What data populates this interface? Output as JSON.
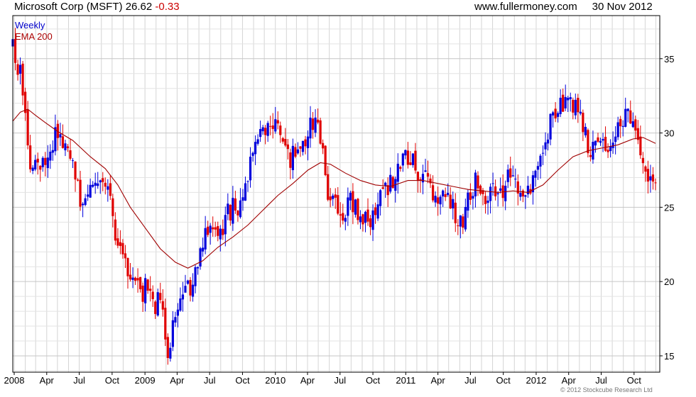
{
  "header": {
    "security": "Microsoft Corp (MSFT)",
    "last_price": "26.62",
    "change": "-0.33",
    "source": "www.fullermoney.com",
    "date": "30 Nov 2012"
  },
  "legend": {
    "weekly": "Weekly",
    "ema": "EMA 200"
  },
  "copyright": "© 2012 Stockcube Research Ltd",
  "colors": {
    "up_candle": "#0000dd",
    "down_candle": "#e00000",
    "ema_line": "#a00000",
    "grid": "#d4d4d4",
    "change_text": "#cc0000"
  },
  "chart_data": {
    "type": "candlestick",
    "grid": true,
    "legend_position": "top-left",
    "y_axis_position": "right",
    "ylim": [
      13.9,
      37.9
    ],
    "y_ticks": [
      15,
      20,
      25,
      30,
      35
    ],
    "x_ticks": [
      {
        "label": "2008",
        "date": "2008-01-01"
      },
      {
        "label": "Apr",
        "date": "2008-04-01"
      },
      {
        "label": "Jul",
        "date": "2008-07-01"
      },
      {
        "label": "Oct",
        "date": "2008-10-01"
      },
      {
        "label": "2009",
        "date": "2009-01-01"
      },
      {
        "label": "Apr",
        "date": "2009-04-01"
      },
      {
        "label": "Jul",
        "date": "2009-07-01"
      },
      {
        "label": "Oct",
        "date": "2009-10-01"
      },
      {
        "label": "2010",
        "date": "2010-01-01"
      },
      {
        "label": "Apr",
        "date": "2010-04-01"
      },
      {
        "label": "Jul",
        "date": "2010-07-01"
      },
      {
        "label": "Oct",
        "date": "2010-10-01"
      },
      {
        "label": "2011",
        "date": "2011-01-01"
      },
      {
        "label": "Apr",
        "date": "2011-04-01"
      },
      {
        "label": "Jul",
        "date": "2011-07-01"
      },
      {
        "label": "Oct",
        "date": "2011-10-01"
      },
      {
        "label": "2012",
        "date": "2012-01-01"
      },
      {
        "label": "Apr",
        "date": "2012-04-01"
      },
      {
        "label": "Jul",
        "date": "2012-07-01"
      },
      {
        "label": "Oct",
        "date": "2012-10-01"
      }
    ],
    "x_range": [
      "2007-12-28",
      "2012-12-12"
    ],
    "close_path": [
      [
        "2007-12-28",
        35.6
      ],
      [
        "2008-01-18",
        34.0
      ],
      [
        "2008-02-01",
        31.0
      ],
      [
        "2008-02-15",
        28.3
      ],
      [
        "2008-03-07",
        27.3
      ],
      [
        "2008-03-28",
        28.5
      ],
      [
        "2008-04-18",
        29.4
      ],
      [
        "2008-05-02",
        30.0
      ],
      [
        "2008-05-16",
        29.5
      ],
      [
        "2008-05-30",
        28.5
      ],
      [
        "2008-06-20",
        27.5
      ],
      [
        "2008-07-04",
        25.6
      ],
      [
        "2008-07-25",
        25.8
      ],
      [
        "2008-08-15",
        27.2
      ],
      [
        "2008-09-05",
        27.4
      ],
      [
        "2008-09-19",
        26.2
      ],
      [
        "2008-10-03",
        24.0
      ],
      [
        "2008-10-17",
        23.0
      ],
      [
        "2008-10-31",
        22.2
      ],
      [
        "2008-11-21",
        19.5
      ],
      [
        "2008-12-05",
        19.8
      ],
      [
        "2008-12-26",
        19.3
      ],
      [
        "2009-01-09",
        19.8
      ],
      [
        "2009-01-30",
        17.8
      ],
      [
        "2009-02-13",
        19.3
      ],
      [
        "2009-03-06",
        15.5
      ],
      [
        "2009-03-27",
        17.8
      ],
      [
        "2009-04-17",
        19.0
      ],
      [
        "2009-05-08",
        19.5
      ],
      [
        "2009-05-29",
        20.8
      ],
      [
        "2009-06-19",
        23.5
      ],
      [
        "2009-07-10",
        23.3
      ],
      [
        "2009-07-31",
        23.5
      ],
      [
        "2009-08-21",
        24.5
      ],
      [
        "2009-09-11",
        25.1
      ],
      [
        "2009-10-02",
        25.3
      ],
      [
        "2009-10-23",
        28.0
      ],
      [
        "2009-11-13",
        29.5
      ],
      [
        "2009-12-04",
        29.8
      ],
      [
        "2009-12-25",
        30.6
      ],
      [
        "2010-01-15",
        30.3
      ],
      [
        "2010-02-05",
        28.2
      ],
      [
        "2010-02-26",
        28.6
      ],
      [
        "2010-03-19",
        29.5
      ],
      [
        "2010-04-09",
        30.4
      ],
      [
        "2010-04-23",
        30.8
      ],
      [
        "2010-05-14",
        28.5
      ],
      [
        "2010-05-28",
        25.8
      ],
      [
        "2010-06-18",
        25.5
      ],
      [
        "2010-07-09",
        24.3
      ],
      [
        "2010-07-30",
        25.8
      ],
      [
        "2010-08-20",
        24.3
      ],
      [
        "2010-09-10",
        24.0
      ],
      [
        "2010-10-01",
        24.4
      ],
      [
        "2010-10-22",
        25.5
      ],
      [
        "2010-11-12",
        26.5
      ],
      [
        "2010-12-03",
        27.3
      ],
      [
        "2010-12-24",
        28.3
      ],
      [
        "2011-01-14",
        28.4
      ],
      [
        "2011-02-04",
        27.5
      ],
      [
        "2011-02-25",
        26.8
      ],
      [
        "2011-03-18",
        25.5
      ],
      [
        "2011-04-08",
        25.8
      ],
      [
        "2011-04-29",
        25.8
      ],
      [
        "2011-05-20",
        24.5
      ],
      [
        "2011-06-10",
        24.0
      ],
      [
        "2011-07-01",
        26.0
      ],
      [
        "2011-07-22",
        27.0
      ],
      [
        "2011-08-12",
        25.5
      ],
      [
        "2011-09-02",
        26.5
      ],
      [
        "2011-09-23",
        25.8
      ],
      [
        "2011-10-14",
        27.0
      ],
      [
        "2011-11-04",
        26.3
      ],
      [
        "2011-11-25",
        25.4
      ],
      [
        "2011-12-16",
        26.2
      ],
      [
        "2012-01-06",
        27.8
      ],
      [
        "2012-01-27",
        29.4
      ],
      [
        "2012-02-17",
        31.3
      ],
      [
        "2012-03-09",
        32.0
      ],
      [
        "2012-03-30",
        32.3
      ],
      [
        "2012-04-20",
        31.8
      ],
      [
        "2012-05-11",
        30.5
      ],
      [
        "2012-06-01",
        28.5
      ],
      [
        "2012-06-22",
        29.8
      ],
      [
        "2012-07-13",
        29.0
      ],
      [
        "2012-08-03",
        29.5
      ],
      [
        "2012-08-24",
        30.7
      ],
      [
        "2012-09-14",
        31.0
      ],
      [
        "2012-10-05",
        29.8
      ],
      [
        "2012-10-26",
        28.4
      ],
      [
        "2012-11-16",
        26.8
      ],
      [
        "2012-11-30",
        26.62
      ]
    ],
    "ema_path": [
      [
        "2007-12-28",
        30.8
      ],
      [
        "2008-01-18",
        31.4
      ],
      [
        "2008-02-08",
        31.6
      ],
      [
        "2008-02-29",
        31.2
      ],
      [
        "2008-03-28",
        30.7
      ],
      [
        "2008-05-02",
        30.1
      ],
      [
        "2008-06-13",
        29.5
      ],
      [
        "2008-08-01",
        28.4
      ],
      [
        "2008-09-12",
        27.6
      ],
      [
        "2008-10-17",
        26.5
      ],
      [
        "2008-11-21",
        25.0
      ],
      [
        "2009-01-02",
        23.6
      ],
      [
        "2009-02-13",
        22.2
      ],
      [
        "2009-03-27",
        21.3
      ],
      [
        "2009-05-01",
        20.9
      ],
      [
        "2009-06-12",
        21.4
      ],
      [
        "2009-07-24",
        22.3
      ],
      [
        "2009-09-04",
        23.0
      ],
      [
        "2009-10-16",
        23.8
      ],
      [
        "2009-11-27",
        24.8
      ],
      [
        "2010-01-08",
        25.8
      ],
      [
        "2010-02-19",
        26.6
      ],
      [
        "2010-04-02",
        27.5
      ],
      [
        "2010-05-07",
        28.0
      ],
      [
        "2010-06-04",
        27.9
      ],
      [
        "2010-07-16",
        27.3
      ],
      [
        "2010-08-27",
        26.8
      ],
      [
        "2010-10-08",
        26.5
      ],
      [
        "2010-11-19",
        26.4
      ],
      [
        "2011-01-07",
        26.8
      ],
      [
        "2011-02-18",
        26.8
      ],
      [
        "2011-04-01",
        26.6
      ],
      [
        "2011-05-13",
        26.4
      ],
      [
        "2011-06-24",
        26.2
      ],
      [
        "2011-08-05",
        26.1
      ],
      [
        "2011-09-16",
        26.0
      ],
      [
        "2011-10-28",
        26.1
      ],
      [
        "2011-12-09",
        26.0
      ],
      [
        "2012-01-20",
        26.5
      ],
      [
        "2012-03-02",
        27.5
      ],
      [
        "2012-04-13",
        28.4
      ],
      [
        "2012-05-25",
        28.8
      ],
      [
        "2012-07-06",
        29.0
      ],
      [
        "2012-08-17",
        29.2
      ],
      [
        "2012-09-28",
        29.6
      ],
      [
        "2012-10-26",
        29.7
      ],
      [
        "2012-11-30",
        29.3
      ]
    ]
  }
}
